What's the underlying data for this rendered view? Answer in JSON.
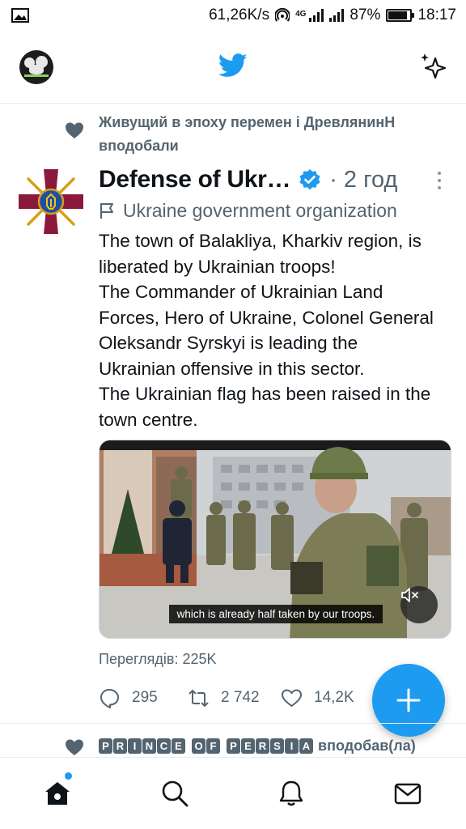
{
  "status_bar": {
    "speed": "61,26K/s",
    "network_tag": "4G",
    "battery": "87%",
    "battery_level": 0.87,
    "time": "18:17"
  },
  "app_bar": {
    "profile_icon": "profile-avatar",
    "logo_icon": "twitter-bird-icon",
    "timeline_icon": "sparkle-icon"
  },
  "social_context": {
    "text": "Живущий в эпоху перемен і ДревлянинН вподобали"
  },
  "tweet": {
    "author_name": "Defense of Ukr…",
    "time": "2 год",
    "separator": "·",
    "label": "Ukraine government organization",
    "text_lines": [
      "The town of Balakliya, Kharkiv region, is",
      "liberated by Ukrainian troops!",
      "The Commander of Ukrainian Land",
      "Forces, Hero of Ukraine, Colonel General",
      "Oleksandr Syrskyi is leading the",
      "Ukrainian offensive in this sector.",
      "The Ukrainian flag has been raised in the",
      "town centre."
    ],
    "video_caption": "which is already half taken by our troops.",
    "views": "Переглядів: 225K",
    "replies": "295",
    "retweets": "2 742",
    "likes": "14,2K"
  },
  "next_context": {
    "name_part1": [
      "P",
      "R",
      "I",
      "N",
      "C",
      "E"
    ],
    "name_part2": [
      "O",
      "F"
    ],
    "name_part3": [
      "P",
      "E",
      "R",
      "S",
      "I",
      "A"
    ],
    "suffix": "вподобав(ла)"
  },
  "bottom_nav": {
    "items": [
      "home-icon",
      "search-icon",
      "notifications-icon",
      "messages-icon"
    ]
  },
  "colors": {
    "accent": "#1d9bf0",
    "secondary_text": "#536471",
    "primary_text": "#0f1419"
  }
}
